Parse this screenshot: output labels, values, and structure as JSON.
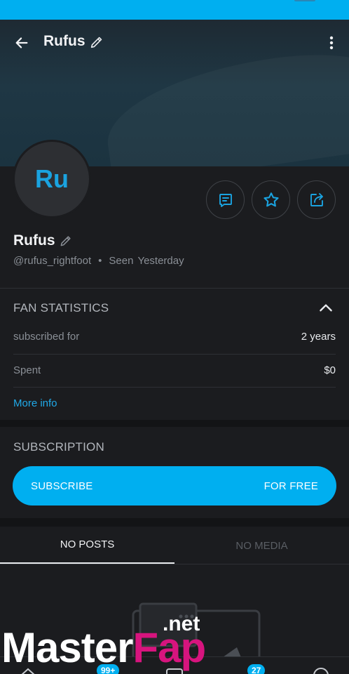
{
  "header": {
    "title": "Rufus"
  },
  "profile": {
    "avatar_initials": "Ru",
    "name": "Rufus",
    "handle": "@rufus_rightfoot",
    "separator": "•",
    "seen_label": "Seen",
    "seen_value": "Yesterday"
  },
  "fan_statistics": {
    "title": "FAN STATISTICS",
    "rows": [
      {
        "label": "subscribed for",
        "value": "2 years"
      },
      {
        "label": "Spent",
        "value": "$0"
      }
    ],
    "more_info": "More info"
  },
  "subscription": {
    "title": "SUBSCRIPTION",
    "button_left": "SUBSCRIBE",
    "button_right": "FOR FREE"
  },
  "tabs": [
    {
      "label": "NO POSTS",
      "active": true
    },
    {
      "label": "NO MEDIA",
      "active": false
    }
  ],
  "bottom_nav": {
    "badges": [
      "99+",
      "27"
    ]
  },
  "watermark": {
    "main_a": "Master",
    "main_b": "Fap",
    "suffix": ".net"
  },
  "colors": {
    "accent": "#00aff0",
    "background": "#1b1c1f",
    "link": "#20a9e8"
  },
  "icons": [
    "back-arrow-icon",
    "pencil-icon",
    "more-vertical-icon",
    "message-icon",
    "star-icon",
    "share-icon",
    "chevron-up-icon"
  ]
}
